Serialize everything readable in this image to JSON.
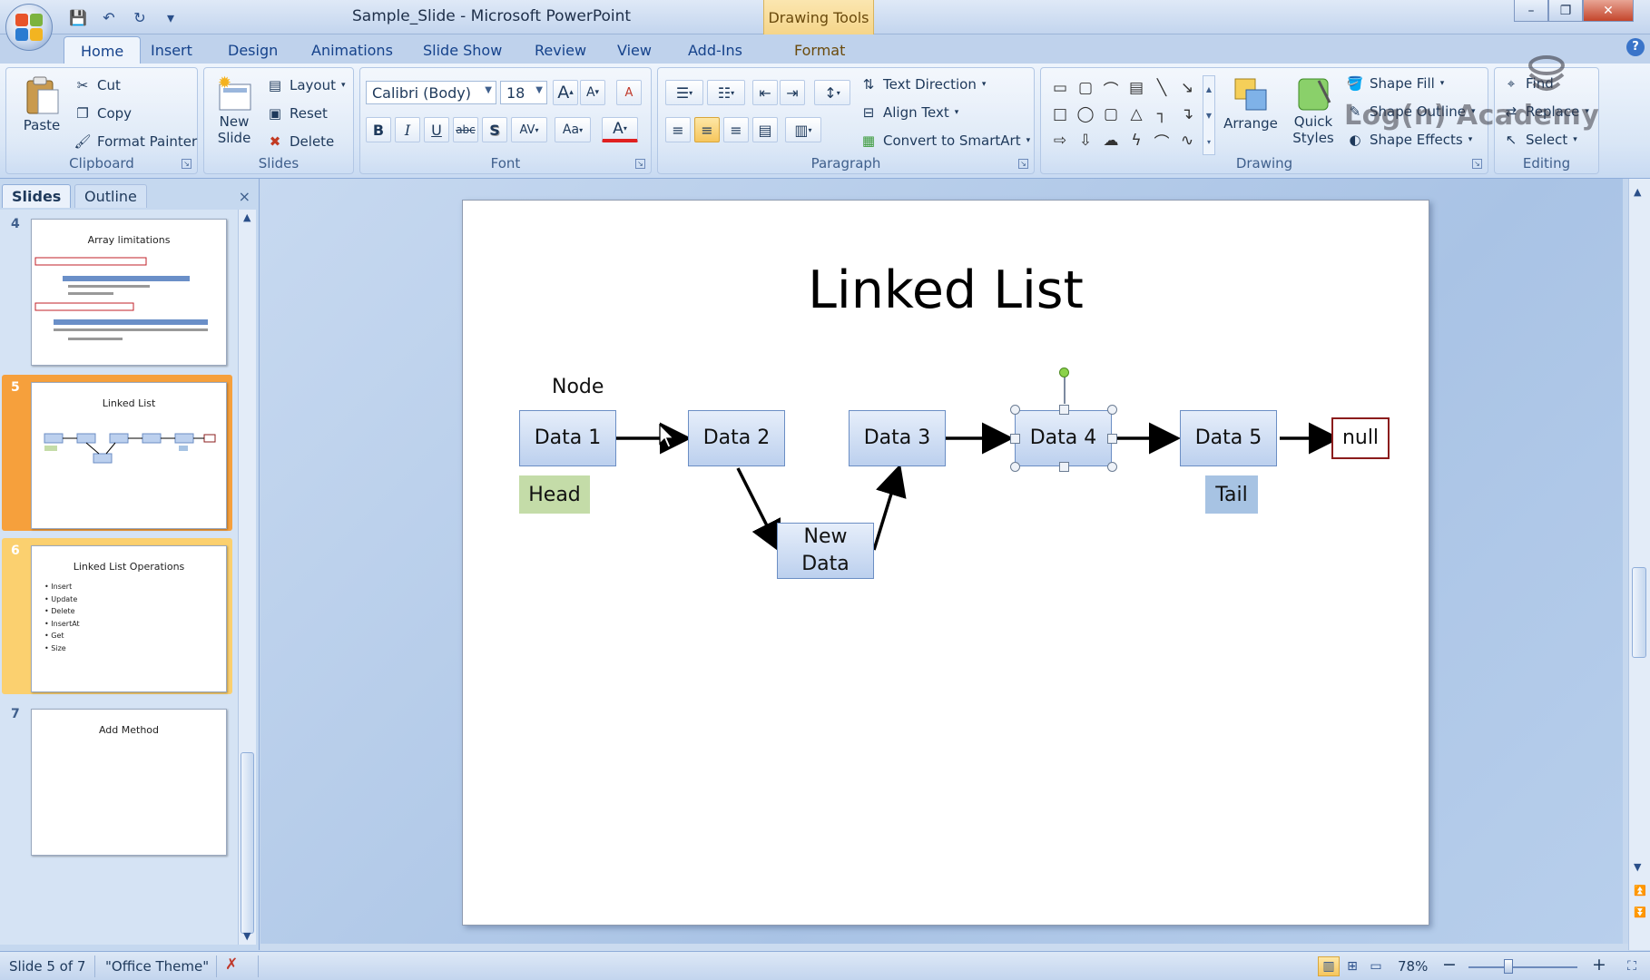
{
  "window": {
    "title": "Sample_Slide - Microsoft PowerPoint",
    "contextual_tab_group": "Drawing Tools",
    "controls": {
      "minimize": "–",
      "restore": "❐",
      "close": "✕"
    }
  },
  "qat": {
    "save_icon": "💾",
    "undo_icon": "↶",
    "redo_icon": "↻",
    "more": "▾"
  },
  "tabs": [
    "Home",
    "Insert",
    "Design",
    "Animations",
    "Slide Show",
    "Review",
    "View",
    "Add-Ins",
    "Format"
  ],
  "active_tab": "Home",
  "help": "?",
  "ribbon": {
    "clipboard": {
      "label": "Clipboard",
      "paste": "Paste",
      "cut": "Cut",
      "copy": "Copy",
      "format_painter": "Format Painter"
    },
    "slides": {
      "label": "Slides",
      "new_slide": "New",
      "new_slide2": "Slide",
      "layout": "Layout",
      "reset": "Reset",
      "delete": "Delete"
    },
    "font": {
      "label": "Font",
      "font_name": "Calibri (Body)",
      "font_size": "18",
      "grow": "A",
      "shrink": "A",
      "clear": "A",
      "bold": "B",
      "italic": "I",
      "underline": "U",
      "strike": "abc",
      "shadow": "S",
      "spacing": "AV",
      "case": "Aa",
      "color": "A"
    },
    "paragraph": {
      "label": "Paragraph",
      "text_direction": "Text Direction",
      "align_text": "Align Text",
      "convert_smartart": "Convert to SmartArt"
    },
    "drawing": {
      "label": "Drawing",
      "arrange": "Arrange",
      "quick": "Quick",
      "styles": "Styles",
      "shape_fill": "Shape Fill",
      "shape_outline": "Shape Outline",
      "shape_effects": "Shape Effects"
    },
    "editing": {
      "label": "Editing",
      "find": "Find",
      "replace": "Replace",
      "select": "Select"
    }
  },
  "pane": {
    "tab_slides": "Slides",
    "tab_outline": "Outline",
    "close": "×"
  },
  "thumbnails": [
    {
      "num": "4",
      "title": "Array limitations",
      "bullets": []
    },
    {
      "num": "5",
      "title": "Linked List",
      "bullets": []
    },
    {
      "num": "6",
      "title": "Linked List Operations",
      "bullets": [
        "Insert",
        "Update",
        "Delete",
        "InsertAt",
        "Get",
        "Size"
      ]
    },
    {
      "num": "7",
      "title": "Add Method",
      "bullets": []
    }
  ],
  "slide": {
    "title": "Linked List",
    "label_node": "Node",
    "nodes": {
      "data1": "Data 1",
      "data2": "Data 2",
      "data3": "Data 3",
      "data4": "Data 4",
      "data5": "Data 5",
      "new_data": "New Data",
      "null": "null"
    },
    "label_head": "Head",
    "label_tail": "Tail"
  },
  "watermark": "Log(n) Academy",
  "status": {
    "slide": "Slide 5 of 7",
    "theme": "\"Office Theme\"",
    "zoom": "78%",
    "zoom_out": "−",
    "zoom_in": "+"
  },
  "colors": {
    "head_fill": "#c4dca8",
    "tail_fill": "#a7c3e3",
    "null_border": "#8b1c1c",
    "selected_thumb": "#f6a03c"
  }
}
